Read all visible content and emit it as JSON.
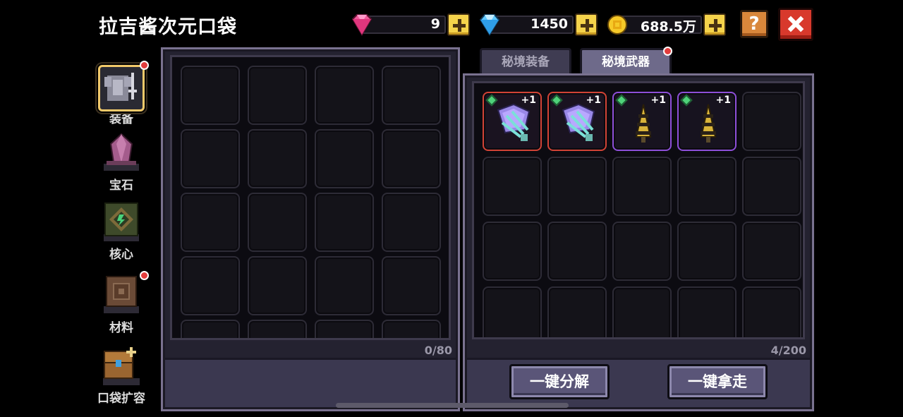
{
  "title": "拉吉酱次元口袋",
  "currencies": {
    "gems": "9",
    "diamonds": "1450",
    "gold": "688.5万"
  },
  "help_label": "?",
  "sidebar": {
    "items": [
      {
        "label": "装备",
        "icon": "armor-icon",
        "selected": true,
        "badge": true
      },
      {
        "label": "宝石",
        "icon": "gem-crystal-icon",
        "selected": false,
        "badge": false
      },
      {
        "label": "核心",
        "icon": "core-icon",
        "selected": false,
        "badge": false
      },
      {
        "label": "材料",
        "icon": "material-box-icon",
        "selected": false,
        "badge": true
      },
      {
        "label": "口袋扩容",
        "icon": "treasure-chest-icon",
        "selected": false,
        "badge": false
      }
    ]
  },
  "left_panel": {
    "count": "0/80"
  },
  "right_panel": {
    "tabs": [
      {
        "label": "秘境装备",
        "active": false
      },
      {
        "label": "秘境武器",
        "active": true
      }
    ],
    "count": "4/200",
    "items": [
      {
        "icon": "crystal-fan-icon",
        "level": "+1",
        "rarity": "red"
      },
      {
        "icon": "crystal-fan-icon",
        "level": "+1",
        "rarity": "red"
      },
      {
        "icon": "drill-cone-icon",
        "level": "+1",
        "rarity": "purple"
      },
      {
        "icon": "drill-cone-icon",
        "level": "+1",
        "rarity": "purple"
      }
    ],
    "buttons": {
      "decompose": "一键分解",
      "take_all": "一键拿走"
    }
  },
  "colors": {
    "red_rarity": "#d14336",
    "purple_rarity": "#8d4fd8",
    "gold_plus": "#f5d34b",
    "close_red": "#d8392c"
  }
}
